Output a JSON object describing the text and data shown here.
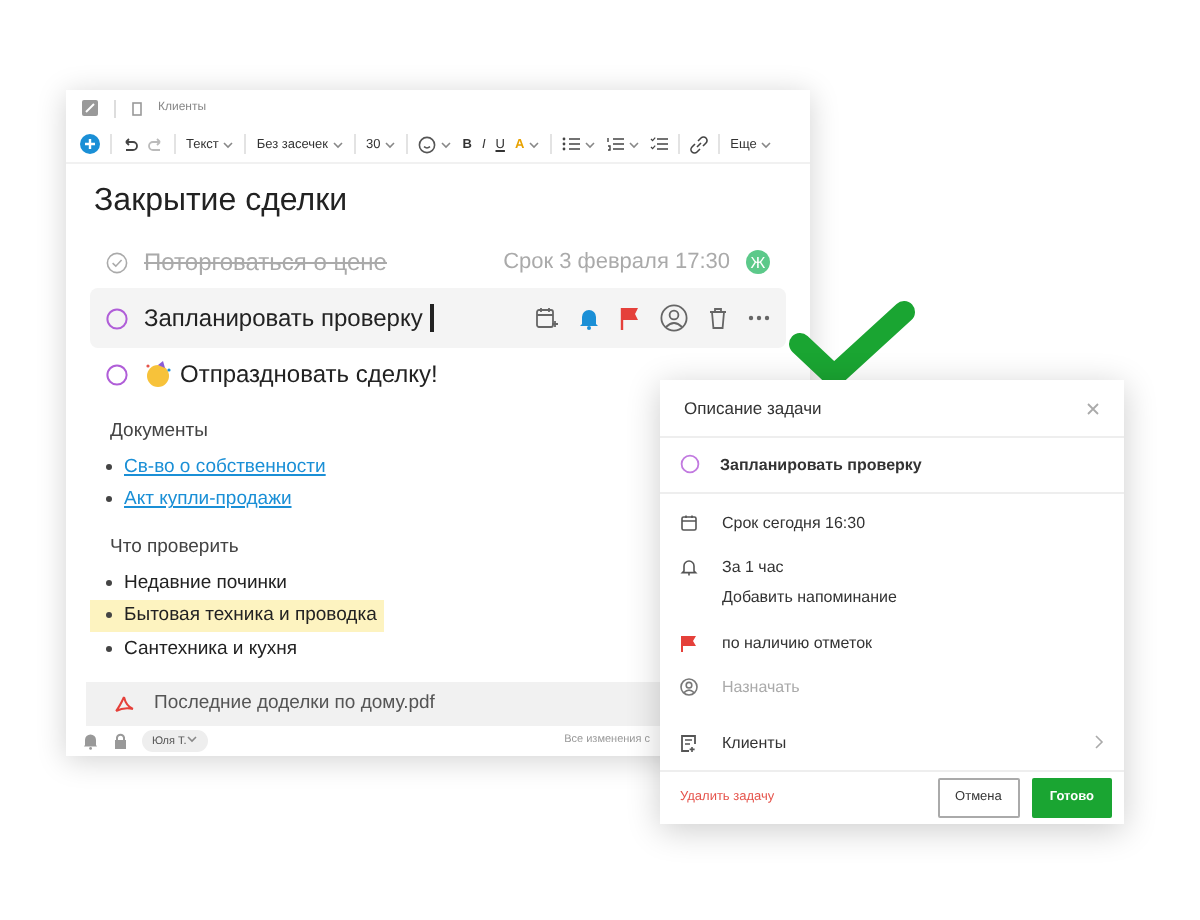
{
  "editor": {
    "breadcrumb": "Клиенты",
    "toolbar": {
      "style": "Текст",
      "font": "Без засечек",
      "size": "30",
      "bold": "B",
      "italic": "I",
      "underline": "U",
      "text_color_label": "A",
      "more": "Еще"
    },
    "title": "Закрытие сделки",
    "tasks": [
      {
        "text": "Поторговаться о цене",
        "done": true,
        "active": false,
        "due": "Срок 3 февраля 17:30",
        "assignee": "Ж"
      },
      {
        "text": "Запланировать проверку",
        "done": false,
        "active": true
      },
      {
        "text": "Отпраздновать сделку!",
        "done": false,
        "active": false,
        "emoji": true
      }
    ],
    "sections": [
      {
        "heading": "Документы",
        "items": [
          {
            "text": "Св-во о собственности",
            "kind": "link",
            "highlighted": false
          },
          {
            "text": "Акт купли-продажи",
            "kind": "link",
            "highlighted": false
          }
        ]
      },
      {
        "heading": "Что проверить",
        "items": [
          {
            "text": "Недавние починки",
            "kind": "text",
            "highlighted": false
          },
          {
            "text": "Бытовая техника и проводка",
            "kind": "text",
            "highlighted": true
          },
          {
            "text": "Сантехника и кухня",
            "kind": "text",
            "highlighted": false
          }
        ]
      }
    ],
    "attachment": "Последние доделки по дому.pdf",
    "footer": {
      "user": "Юля Т.",
      "status": "Все изменения с"
    }
  },
  "dialog": {
    "title": "Описание задачи",
    "task": "Запланировать проверку",
    "rows": [
      {
        "kind": "due",
        "text": "Срок сегодня 16:30",
        "disabled": false
      },
      {
        "kind": "reminder",
        "text": "За 1 час",
        "sub": "Добавить напоминание",
        "disabled": false
      },
      {
        "kind": "flag",
        "text": "по наличию отметок",
        "disabled": false
      },
      {
        "kind": "assign",
        "text": "Назначать",
        "disabled": true
      },
      {
        "kind": "list",
        "text": "Клиенты",
        "disabled": false
      }
    ],
    "delete": "Удалить задачу",
    "buttons": [
      {
        "label": "Отмена",
        "primary": false
      },
      {
        "label": "Готово",
        "primary": true
      }
    ]
  }
}
